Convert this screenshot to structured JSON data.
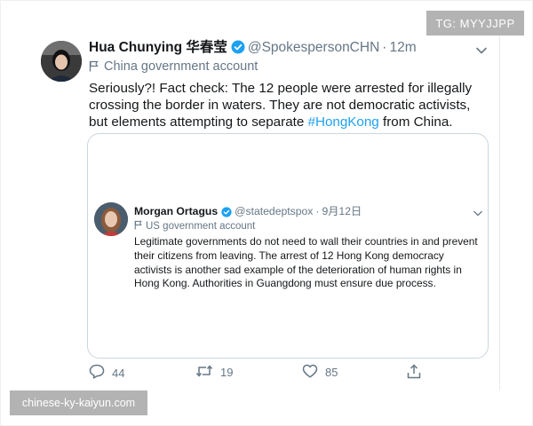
{
  "colors": {
    "accent": "#1da1f2",
    "muted": "#657786",
    "text": "#14171a",
    "border": "#ccd6dd",
    "badge_bg": "#b3b3b3"
  },
  "watermarks": {
    "top_right": "TG: MYYJJPP",
    "bottom_left": "chinese-ky-kaiyun.com"
  },
  "tweet": {
    "author_name": "Hua Chunying 华春莹",
    "handle": "@SpokespersonCHN",
    "separator": "·",
    "time": "12m",
    "gov_label": "China government account",
    "text_before_tag": "Seriously?! Fact check: The 12 people were arrested for illegally crossing the border in waters. They are not democratic activists, but elements attempting to separate ",
    "hashtag": "#HongKong",
    "text_after_tag": " from China.",
    "icons": {
      "verified": "verified-badge-icon",
      "caret": "chevron-down-icon",
      "flag": "flag-icon"
    }
  },
  "quoted": {
    "author_name": "Morgan Ortagus",
    "handle": "@statedeptspox",
    "separator": "·",
    "time": "9月12日",
    "gov_label": "US government account",
    "text": "Legitimate governments do not need to wall their countries in and prevent their citizens from leaving. The arrest of 12 Hong Kong democracy activists is another sad example of the deterioration of human rights in Hong Kong. Authorities in Guangdong must ensure due process."
  },
  "actions": {
    "reply_count": "44",
    "retweet_count": "19",
    "like_count": "85",
    "icons": [
      "reply-icon",
      "retweet-icon",
      "like-icon",
      "share-icon"
    ]
  }
}
